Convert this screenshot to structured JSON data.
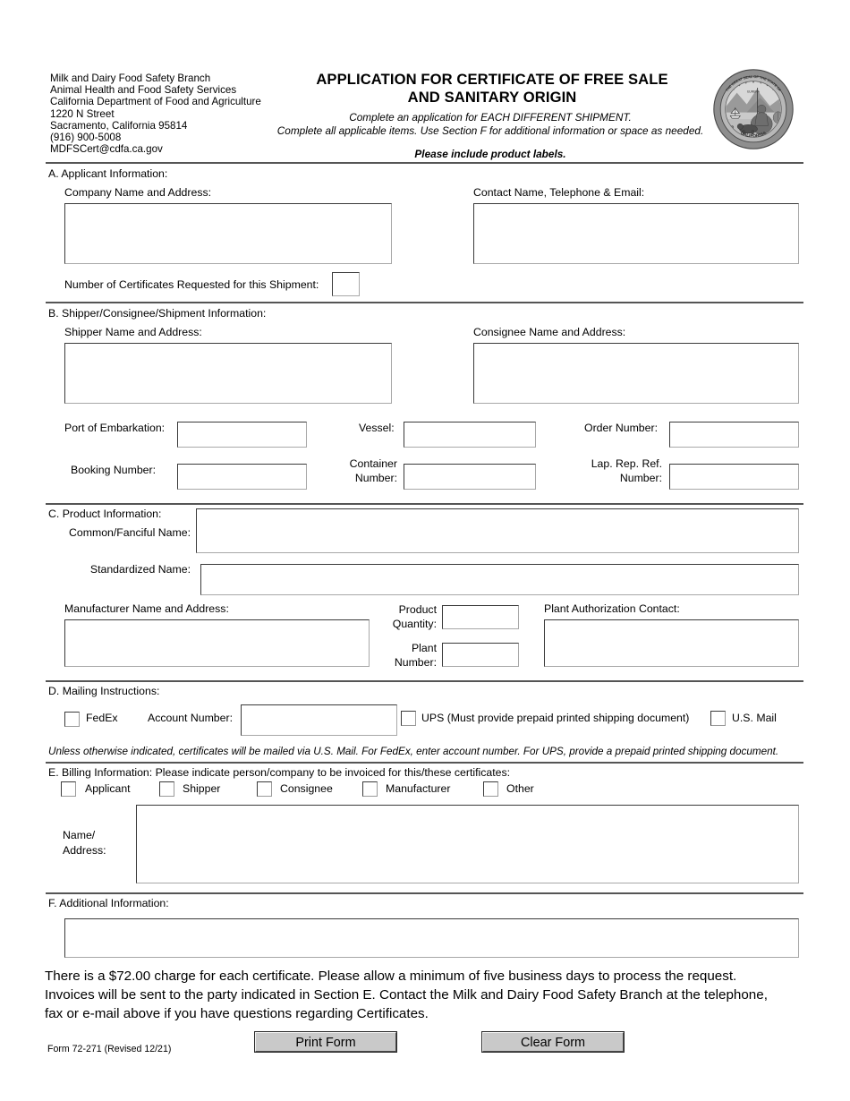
{
  "header": {
    "agency_address": "Milk and Dairy Food Safety Branch\nAnimal Health and Food Safety Services\nCalifornia Department of Food and Agriculture\n1220 N Street\nSacramento, California 95814\n(916) 900-5008\nMDFSCert@cdfa.ca.gov",
    "title_line1": "APPLICATION FOR CERTIFICATE OF FREE SALE",
    "title_line2": "AND SANITARY ORIGIN",
    "subtitle_line1": "Complete an application for EACH DIFFERENT SHIPMENT.",
    "subtitle_line2": "Complete all applicable items. Use Section F for additional information or space as needed.",
    "subtitle_bold": "Please include product labels.",
    "seal_text_top": "THE GREAT SEAL OF THE STATE OF",
    "seal_text_bottom": "CALIFORNIA",
    "seal_motto": "EUREKA"
  },
  "section_a": {
    "heading": "A.  Applicant Information:",
    "company_label": "Company Name and Address:",
    "company_value": "",
    "contact_label": "Contact Name, Telephone & Email:",
    "contact_value": "",
    "certificates_label": "Number of Certificates Requested for this Shipment:",
    "certificates_value": ""
  },
  "section_b": {
    "heading": "B.  Shipper/Consignee/Shipment Information:",
    "shipper_label": "Shipper Name and Address:",
    "shipper_value": "",
    "consignee_label": "Consignee Name and Address:",
    "consignee_value": "",
    "port_label": "Port of Embarkation:",
    "port_value": "",
    "vessel_label": "Vessel:",
    "vessel_value": "",
    "order_label": "Order Number:",
    "order_value": "",
    "booking_label": "Booking Number:",
    "booking_value": "",
    "container_label_line1": "Container",
    "container_label_line2": "Number:",
    "container_value": "",
    "lap_label_line1": "Lap. Rep. Ref.",
    "lap_label_line2": "Number:",
    "lap_value": ""
  },
  "section_c": {
    "heading": "C.  Product Information:",
    "common_label": "Common/Fanciful Name:",
    "common_value": "",
    "standardized_label": "Standardized Name:",
    "standardized_value": "",
    "manufacturer_label": "Manufacturer Name and Address:",
    "manufacturer_value": "",
    "quantity_label_line1": "Product",
    "quantity_label_line2": "Quantity:",
    "quantity_value": "",
    "plantno_label_line1": "Plant",
    "plantno_label_line2": "Number:",
    "plantno_value": "",
    "plant_contact_label": "Plant Authorization Contact:",
    "plant_contact_value": ""
  },
  "section_d": {
    "heading": "D.  Mailing Instructions:",
    "fedex_label": "FedEx",
    "account_label": "Account Number:",
    "account_value": "",
    "ups_label": "UPS (Must provide prepaid printed shipping document)",
    "usmail_label": "U.S. Mail",
    "note": "Unless otherwise indicated, certificates will be mailed via U.S. Mail. For FedEx, enter account number. For UPS, provide a prepaid printed shipping document."
  },
  "section_e": {
    "heading": "E.  Billing Information: Please indicate person/company to be invoiced for this/these certificates:",
    "options": [
      "Applicant",
      "Shipper",
      "Consignee",
      "Manufacturer",
      "Other"
    ],
    "name_label_line1": "Name/",
    "name_label_line2": "Address:",
    "name_value": ""
  },
  "section_f": {
    "heading": "F.  Additional Information:",
    "value": ""
  },
  "footer": {
    "notice_line1": "There is a $72.00 charge for each certificate. Please allow a minimum of five business days to process the request.",
    "notice_line2": "Invoices will be sent to the party indicated in Section E. Contact the Milk and Dairy Food Safety Branch at the telephone,",
    "notice_line3": "fax or e-mail above if you have questions regarding Certificates.",
    "form_number": "Form 72-271 (Revised 12/21)",
    "print_button": "Print Form",
    "clear_button": "Clear Form"
  },
  "colors": {
    "rule": "#555555",
    "field_border_dark": "#3a3a3a",
    "field_border_light": "#a8a8a8",
    "button_face": "#c9c9c9",
    "seal_gray": "#808080"
  }
}
